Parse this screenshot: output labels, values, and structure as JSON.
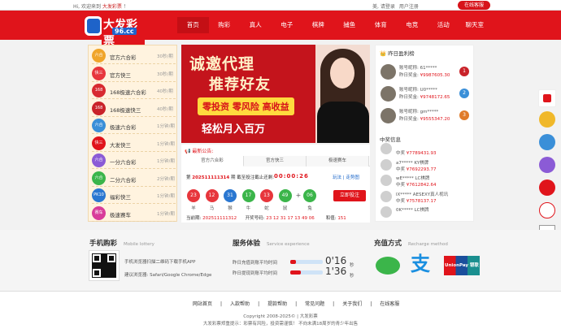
{
  "topbar": {
    "welcome": "Hi, 欢迎来到",
    "site": "大发彩票",
    "excl": "！",
    "login": "美, 请登录",
    "register": "用户注册",
    "service": "在线客服"
  },
  "logo": {
    "text": "大发彩票",
    "sub": "96.cc"
  },
  "nav": [
    "首页",
    "购彩",
    "真人",
    "电子",
    "棋牌",
    "捕鱼",
    "体育",
    "电竞",
    "活动",
    "聊天室"
  ],
  "lottery": [
    {
      "badge": "六合",
      "name": "官方六合彩",
      "period": "30秒/期",
      "color": "#f0a52a"
    },
    {
      "badge": "快三",
      "name": "官方快三",
      "period": "30秒/期",
      "color": "#e7363c"
    },
    {
      "badge": "168",
      "name": "168极速六合彩",
      "period": "40秒/期",
      "color": "#d82a30"
    },
    {
      "badge": "168",
      "name": "168极速快三",
      "period": "40秒/期",
      "color": "#c9232a"
    },
    {
      "badge": "六合",
      "name": "极速六合彩",
      "period": "1分钟/期",
      "color": "#3a8fd8"
    },
    {
      "badge": "快三",
      "name": "大发快三",
      "period": "1分钟/期",
      "color": "#e0141b"
    },
    {
      "badge": "六合",
      "name": "一分六合彩",
      "period": "1分钟/期",
      "color": "#8b5bd6"
    },
    {
      "badge": "六合",
      "name": "二分六合彩",
      "period": "2分钟/期",
      "color": "#3bb54a"
    },
    {
      "badge": "PK10",
      "name": "福彩快三",
      "period": "1分钟/期",
      "color": "#2a77d1"
    },
    {
      "badge": "赛车",
      "name": "极速赛车",
      "period": "1分钟/期",
      "color": "#d83c9a"
    }
  ],
  "banner": {
    "line1": "诚邀代理",
    "line2": "推荐好友",
    "line3": "零投资 零风险 高收益",
    "line4": "轻松月入百万"
  },
  "draw": {
    "announce": "最新公告:",
    "tabs": [
      "官方六合彩",
      "官方快三",
      "极速赛车"
    ],
    "issue_pre": "第",
    "issue": "202511111314",
    "issue_post": "期 截至投注截止还剩:",
    "countdown": "00:00:26",
    "trend": "玩法",
    "history": "走势图",
    "balls": [
      {
        "num": "23",
        "zod": "羊",
        "color": "#e7363c"
      },
      {
        "num": "12",
        "zod": "马",
        "color": "#e7363c"
      },
      {
        "num": "31",
        "zod": "猴",
        "color": "#2a77d1"
      },
      {
        "num": "17",
        "zod": "牛",
        "color": "#3bb54a"
      },
      {
        "num": "13",
        "zod": "蛇",
        "color": "#e7363c"
      },
      {
        "num": "49",
        "zod": "鼠",
        "color": "#3bb54a"
      },
      {
        "num": "06",
        "zod": "兔",
        "color": "#3bb54a"
      }
    ],
    "plus": "+",
    "bet": "立即投注",
    "cur_label": "当前期:",
    "cur": "202511111312",
    "open_label": "开奖号码:",
    "open": "23 12 31 17 13 49 06",
    "sum_label": "和值:",
    "sum": "151"
  },
  "winners": {
    "title": "昨日盈利榜",
    "rows": [
      {
        "name": "账号昵称: 61*****",
        "amt_label": "昨日奖金:",
        "amt": "¥9987605.30",
        "rank": "1",
        "rcolor": "#c9232a"
      },
      {
        "name": "账号昵称: U0*****",
        "amt_label": "昨日奖金:",
        "amt": "¥9748172.65",
        "rank": "2",
        "rcolor": "#3a8fd8"
      },
      {
        "name": "账号昵称: gm*****",
        "amt_label": "昨日奖金:",
        "amt": "¥9555347.20",
        "rank": "3",
        "rcolor": "#e07b2a"
      }
    ],
    "title2": "中奖信息",
    "news": [
      {
        "name": "",
        "amt_label": "中奖",
        "amt": "¥7789431.93"
      },
      {
        "name": "a7***** KY棋牌",
        "amt_label": "中奖",
        "amt": "¥7692293.77"
      },
      {
        "name": "wE***** LC棋牌",
        "amt_label": "中奖",
        "amt": "¥7612842.64"
      },
      {
        "name": "lX***** AESEXY真人视讯",
        "amt_label": "中奖",
        "amt": "¥7578137.17"
      },
      {
        "name": "0K***** LC棋牌",
        "amt_label": "",
        "amt": ""
      }
    ]
  },
  "services": {
    "mobile": {
      "title": "手机购彩",
      "sub": "Mobile lottery",
      "line1": "手机浏览器扫描二维码下载手机APP",
      "line2": "建议浏览器: Safari/Google Chrome/Edge"
    },
    "service": {
      "title": "服务体验",
      "sub": "Service experience",
      "dep": "昨日充值到账平均时间",
      "wd": "昨日提现到账平均时间",
      "dep_val": "0'16",
      "wd_val": "1'36",
      "unit": "秒",
      "dep_fill": 0.18,
      "wd_fill": 0.32
    },
    "recharge": {
      "title": "充值方式",
      "sub": "Recharge method",
      "unionpay": "UnionPay 银联"
    }
  },
  "footer": {
    "links": [
      "网站首页",
      "入款帮助",
      "提款帮助",
      "常见问题",
      "关于我们",
      "在线客服"
    ],
    "copyright": "Copyright 2008-2025© | 大发彩票",
    "notice": "大发彩票郑重提示：彩票有风险，投资需谨慎！ 不向未满18周岁的青少年出售"
  }
}
